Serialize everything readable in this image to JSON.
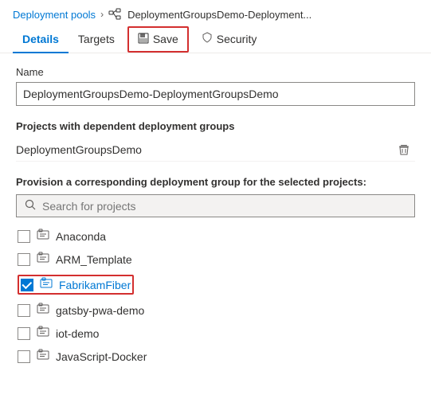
{
  "breadcrumb": {
    "link_label": "Deployment pools",
    "separator": ">",
    "icon_label": "deployment-groups-icon",
    "current": "DeploymentGroupsDemo-Deployment..."
  },
  "tabs": {
    "details": "Details",
    "targets": "Targets",
    "save": "Save",
    "security": "Security"
  },
  "form": {
    "name_label": "Name",
    "name_value": "DeploymentGroupsDemo-DeploymentGroupsDemo",
    "projects_section_title": "Projects with dependent deployment groups",
    "dependent_project": "DeploymentGroupsDemo",
    "provision_label": "Provision a corresponding deployment group for the selected projects:",
    "search_placeholder": "Search for projects"
  },
  "projects": [
    {
      "id": "anaconda",
      "name": "Anaconda",
      "checked": false
    },
    {
      "id": "arm-template",
      "name": "ARM_Template",
      "checked": false
    },
    {
      "id": "fabrikam-fiber",
      "name": "FabrikamFiber",
      "checked": true,
      "highlighted": true
    },
    {
      "id": "gatsby-pwa-demo",
      "name": "gatsby-pwa-demo",
      "checked": false
    },
    {
      "id": "iot-demo",
      "name": "iot-demo",
      "checked": false
    },
    {
      "id": "javascript-docker",
      "name": "JavaScript-Docker",
      "checked": false
    }
  ],
  "colors": {
    "accent": "#0078d4",
    "highlight_border": "#d32f2f",
    "checked_bg": "#0078d4"
  }
}
